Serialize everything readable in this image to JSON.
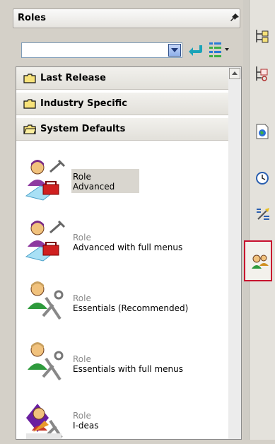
{
  "panel": {
    "title": "Roles",
    "search": {
      "value": "",
      "placeholder": ""
    }
  },
  "groups": [
    {
      "label": "Last Release"
    },
    {
      "label": "Industry Specific"
    },
    {
      "label": "System Defaults"
    }
  ],
  "roles": [
    {
      "label": "Role",
      "name": "Advanced",
      "selected": true
    },
    {
      "label": "Role",
      "name": "Advanced with full menus",
      "selected": false
    },
    {
      "label": "Role",
      "name": "Essentials (Recommended)",
      "selected": false
    },
    {
      "label": "Role",
      "name": "Essentials with full menus",
      "selected": false
    },
    {
      "label": "Role",
      "name": "I-deas",
      "selected": false
    }
  ],
  "sidebar": {
    "tabs": [
      {
        "icon": "assembly-navigator-icon"
      },
      {
        "icon": "constraint-navigator-icon"
      },
      {
        "icon": "web-browser-icon"
      },
      {
        "icon": "history-icon"
      },
      {
        "icon": "process-studio-icon"
      },
      {
        "icon": "roles-icon",
        "active": true
      }
    ]
  },
  "colors": {
    "accent": "#c8102e",
    "selection": "#d9d6cf"
  }
}
